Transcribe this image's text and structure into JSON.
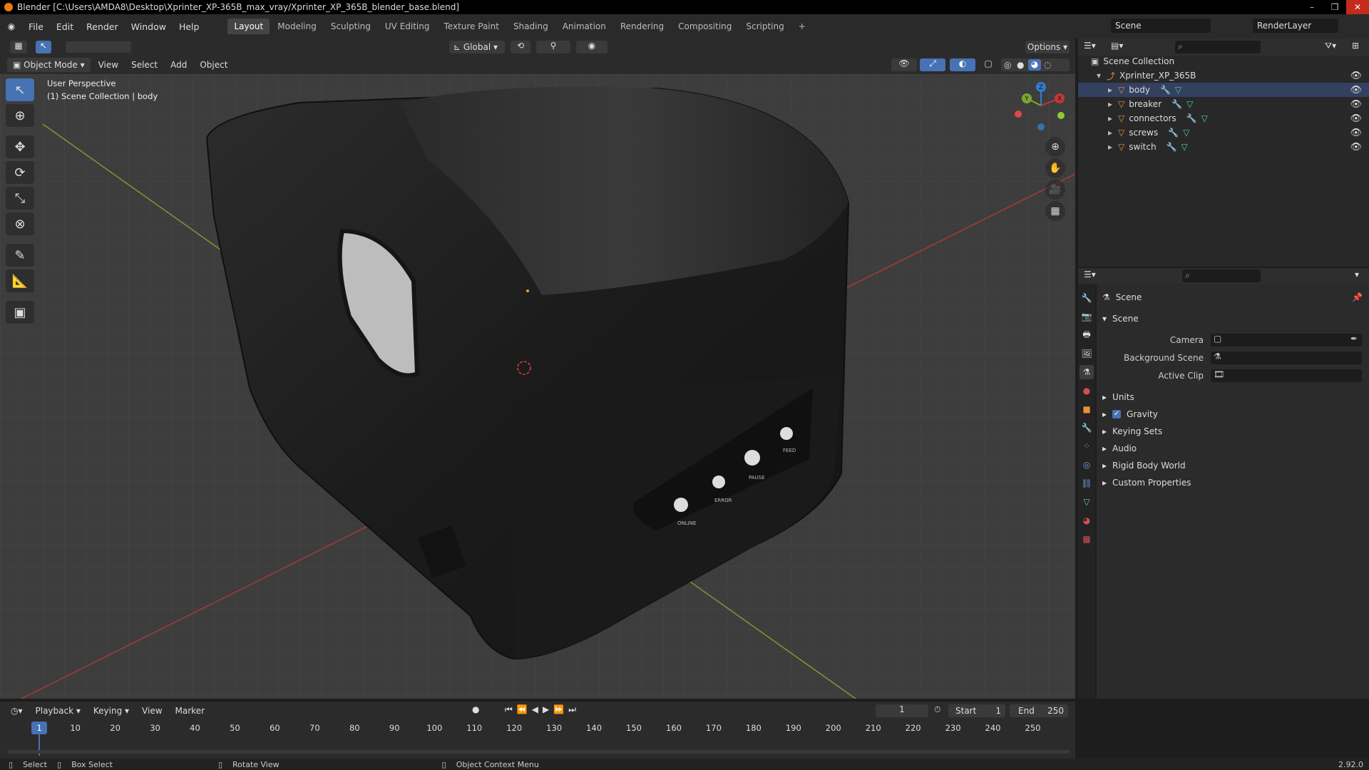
{
  "window": {
    "title": "Blender [C:\\Users\\AMDA8\\Desktop\\Xprinter_XP-365B_max_vray/Xprinter_XP_365B_blender_base.blend]",
    "controls": [
      "–",
      "❐",
      "✕"
    ]
  },
  "menu": [
    "File",
    "Edit",
    "Render",
    "Window",
    "Help"
  ],
  "workspaces": [
    {
      "label": "Layout",
      "active": true
    },
    {
      "label": "Modeling"
    },
    {
      "label": "Sculpting"
    },
    {
      "label": "UV Editing"
    },
    {
      "label": "Texture Paint"
    },
    {
      "label": "Shading"
    },
    {
      "label": "Animation"
    },
    {
      "label": "Rendering"
    },
    {
      "label": "Compositing"
    },
    {
      "label": "Scripting"
    }
  ],
  "scene_name": "Scene",
  "render_layer": "RenderLayer",
  "viewport": {
    "transform_orientation": "Global",
    "options_label": "Options",
    "mode": "Object Mode",
    "header_menus": [
      "View",
      "Select",
      "Add",
      "Object"
    ],
    "info_line1": "User Perspective",
    "info_line2": "(1) Scene Collection | body",
    "gizmo": {
      "z": "Z",
      "y": "Y",
      "x": "X"
    }
  },
  "outliner": {
    "root": "Scene Collection",
    "collection": "Xprinter_XP_365B",
    "objects": [
      "body",
      "breaker",
      "connectors",
      "screws",
      "switch"
    ]
  },
  "properties": {
    "context": "Scene",
    "panel_title": "Scene",
    "fields": [
      {
        "label": "Camera"
      },
      {
        "label": "Background Scene"
      },
      {
        "label": "Active Clip"
      }
    ],
    "panels": [
      "Units",
      "Gravity",
      "Keying Sets",
      "Audio",
      "Rigid Body World",
      "Custom Properties"
    ],
    "gravity_checked": true
  },
  "timeline": {
    "menus": [
      "Playback",
      "Keying",
      "View",
      "Marker"
    ],
    "current_frame": "1",
    "start_label": "Start",
    "start": "1",
    "end_label": "End",
    "end": "250",
    "ticks": [
      "1",
      "10",
      "20",
      "30",
      "40",
      "50",
      "60",
      "70",
      "80",
      "90",
      "100",
      "110",
      "120",
      "130",
      "140",
      "150",
      "160",
      "170",
      "180",
      "190",
      "200",
      "210",
      "220",
      "230",
      "240",
      "250"
    ]
  },
  "statusbar": {
    "items": [
      "Select",
      "Box Select",
      "Rotate View",
      "Object Context Menu"
    ],
    "version": "2.92.0"
  },
  "model_labels": [
    "ONLINE",
    "ERROR",
    "PAUSE",
    "FEED"
  ]
}
